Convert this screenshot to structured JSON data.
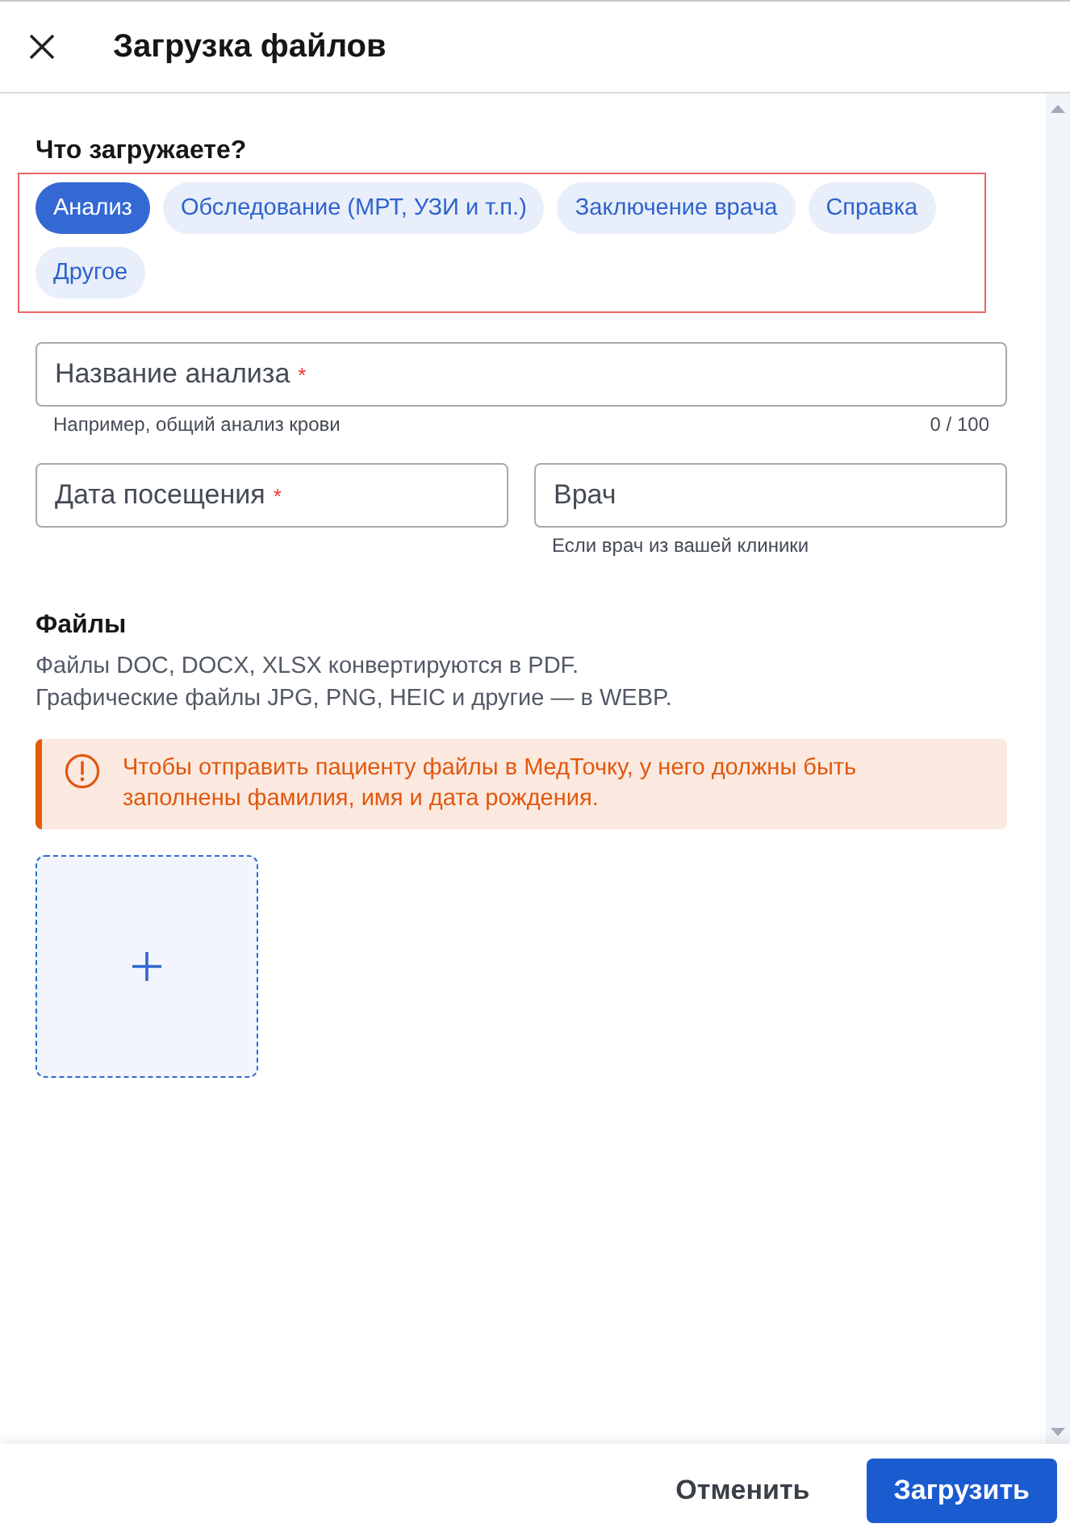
{
  "header": {
    "title": "Загрузка файлов"
  },
  "type_picker": {
    "label": "Что загружаете?",
    "highlighted": true,
    "options": [
      {
        "label": "Анализ",
        "selected": true
      },
      {
        "label": "Обследование (МРТ, УЗИ и т.п.)",
        "selected": false
      },
      {
        "label": "Заключение врача",
        "selected": false
      },
      {
        "label": "Справка",
        "selected": false
      },
      {
        "label": "Другое",
        "selected": false
      }
    ]
  },
  "field_rows": [
    {
      "fields": [
        {
          "placeholder": "Название анализа",
          "required_mark": "*",
          "hint": "Например, общий анализ крови",
          "counter": "0 / 100"
        }
      ]
    },
    {
      "fields": [
        {
          "placeholder": "Дата посещения",
          "required_mark": "*"
        },
        {
          "placeholder": "Врач",
          "hint": "Если врач из вашей клиники"
        }
      ]
    }
  ],
  "files": {
    "title": "Файлы",
    "description": [
      "Файлы DOC, DOCX, XLSX конвертируются в PDF.",
      "Графические файлы JPG, PNG, HEIC и другие — в WEBP."
    ],
    "alert": {
      "kind": "warning",
      "text": "Чтобы отправить пациенту файлы в МедТочку, у него должны быть заполнены фамилия, имя и дата рождения."
    }
  },
  "footer": {
    "buttons": [
      {
        "kind": "secondary",
        "label": "Отменить"
      },
      {
        "kind": "primary",
        "label": "Загрузить"
      }
    ]
  }
}
